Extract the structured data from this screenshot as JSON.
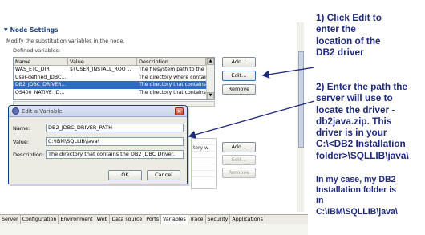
{
  "node_settings": {
    "title": "Node Settings",
    "description": "Modify the substitution variables in the node.",
    "defined_label": "Defined variables:",
    "columns": [
      "Name",
      "Value",
      "Description"
    ],
    "rows": [
      {
        "name": "WAS_ETC_DIR",
        "value": "${USER_INSTALL_ROOT...",
        "description": "The filesystem path to the d"
      },
      {
        "name": "User-defined_JDBC...",
        "value": "",
        "description": "The directory where contains"
      },
      {
        "name": "DB2_JDBC_DRIVER...",
        "value": "",
        "description": "The directory that contains"
      },
      {
        "name": "OS400_NATIVE_JD...",
        "value": "",
        "description": "The directory that contains"
      }
    ],
    "buttons": {
      "add": "Add...",
      "edit": "Edit...",
      "remove": "Remove"
    }
  },
  "lower_section": {
    "buttons": {
      "add": "Add...",
      "edit": "Edit...",
      "remove": "Remove"
    },
    "partial_text": "tory w"
  },
  "dialog": {
    "title": "Edit a Variable",
    "name_label": "Name:",
    "name_value": "DB2_JDBC_DRIVER_PATH",
    "value_label": "Value:",
    "value_value": "C:\\IBM\\SQLLIB\\java\\",
    "description_label": "Description:",
    "description_value": "The directory that contains the DB2 JDBC Driver.",
    "ok": "OK",
    "cancel": "Cancel"
  },
  "bottom_tabs": [
    "Server",
    "Configuration",
    "Environment",
    "Web",
    "Data source",
    "Ports",
    "Variables",
    "Trace",
    "Security",
    "Applications"
  ],
  "annotations": {
    "step1": [
      "1) Click Edit to",
      "enter the",
      "location of the",
      "DB2 driver"
    ],
    "step2": [
      "2) Enter the path the",
      "server will use to",
      "locate the driver -",
      "db2java.zip. This",
      "driver is in your",
      "C:\\<DB2 Installation",
      "folder>\\SQLLIB\\java\\"
    ],
    "note": [
      "In my case, my DB2",
      "Installation folder is",
      "in",
      "C:\\IBM\\SQLLIB\\java\\"
    ]
  },
  "colors": {
    "annotation": "#1f2a7c",
    "selection": "#316ac5",
    "section_title": "#1a3c78"
  }
}
